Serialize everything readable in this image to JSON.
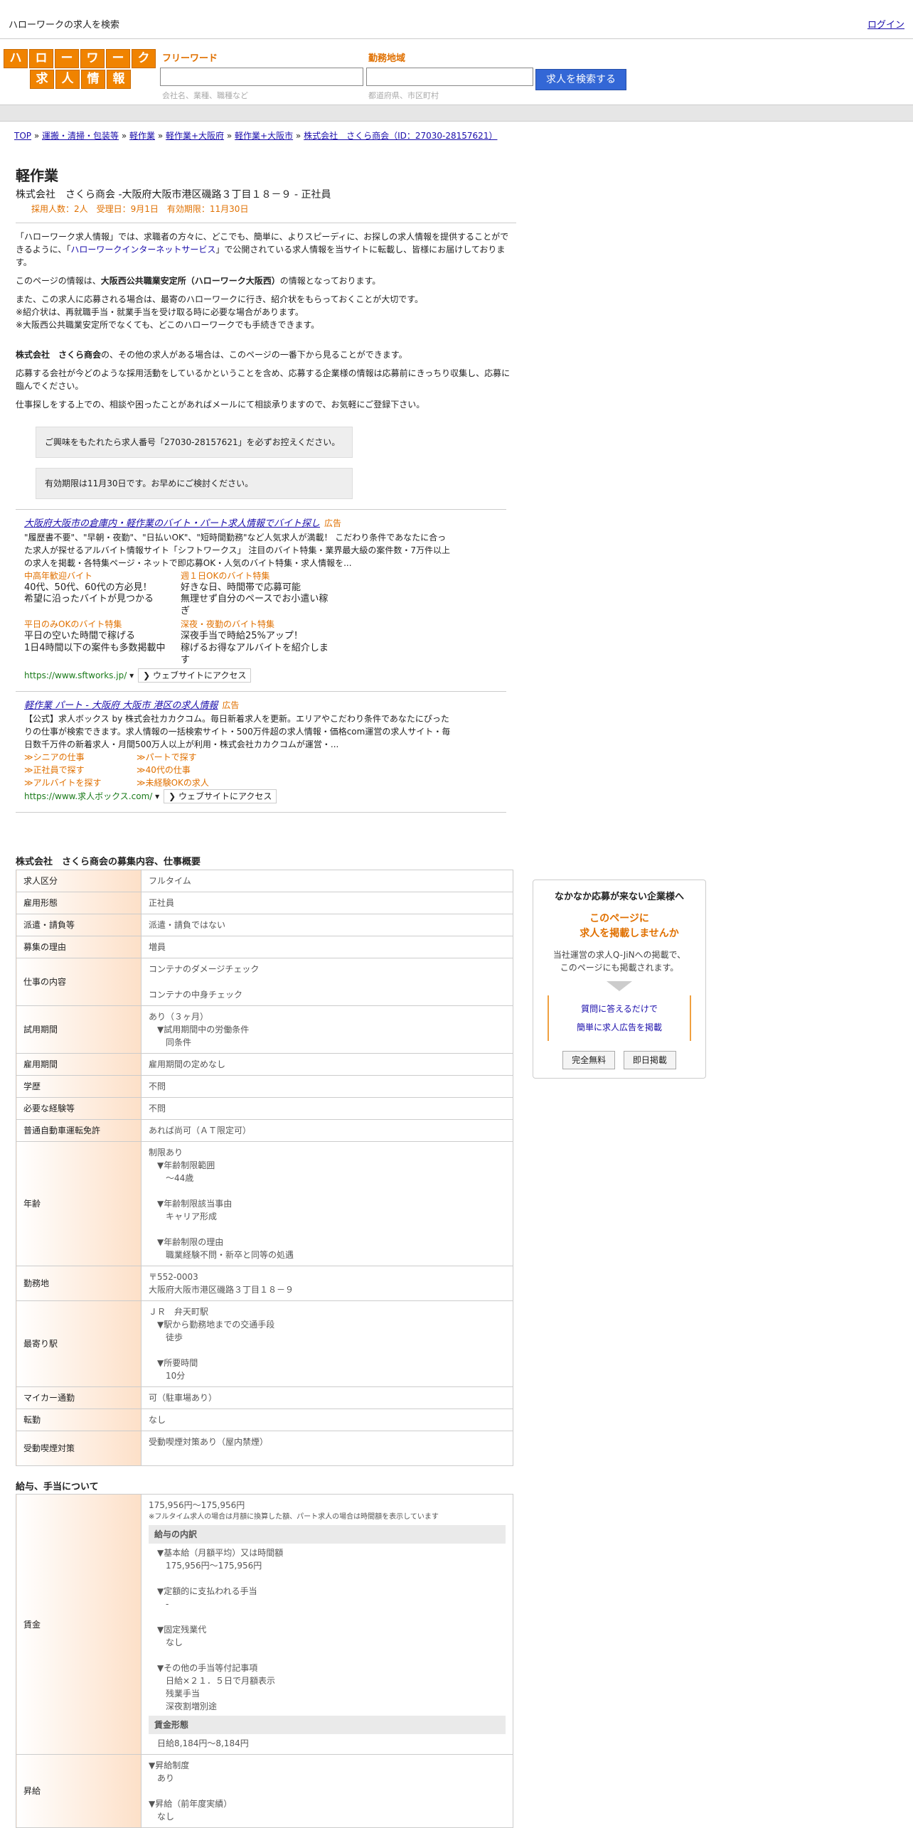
{
  "topbar": {
    "site_title": "ハローワークの求人を検索",
    "login": "ログイン"
  },
  "logo": {
    "row1": [
      "ハ",
      "ロ",
      "ー",
      "ワ",
      "ー",
      "ク"
    ],
    "row2": [
      "求",
      "人",
      "情",
      "報"
    ]
  },
  "search": {
    "keyword_label": "フリーワード",
    "keyword_hint": "会社名、業種、職種など",
    "area_label": "勤務地域",
    "area_hint": "都道府県、市区町村",
    "button": "求人を検索する"
  },
  "breadcrumb": [
    "TOP",
    "運搬・清掃・包装等",
    "軽作業",
    "軽作業+大阪府",
    "軽作業+大阪市",
    "株式会社　さくら商会（ID：27030-28157621）"
  ],
  "job": {
    "title": "軽作業",
    "company_line": "株式会社　さくら商会 -大阪府大阪市港区磯路３丁目１８－９ - 正社員",
    "meta": "採用人数：2人　受理日：9月1日　有効期限：11月30日"
  },
  "intro": {
    "p1_a": "「ハローワーク求人情報」では、求職者の方々に、どこでも、簡単に、よりスピーディに、お探しの求人情報を提供することができるように、「",
    "p1_link": "ハローワークインターネットサービス",
    "p1_b": "」で公開されている求人情報を当サイトに転載し、皆様にお届けしております。",
    "p2_a": "このページの情報は、",
    "p2_bold": "大阪西公共職業安定所（ハローワーク大阪西）",
    "p2_b": "の情報となっております。",
    "p3_1": "また、この求人に応募される場合は、最寄のハローワークに行き、紹介状をもらっておくことが大切です。",
    "p3_2": "※紹介状は、再就職手当・就業手当を受け取る時に必要な場合があります。",
    "p3_3": "※大阪西公共職業安定所でなくても、どこのハローワークでも手続きできます。",
    "p4_bold": "株式会社　さくら商会",
    "p4_b": "の、その他の求人がある場合は、このページの一番下から見ることができます。",
    "p5": "応募する会社が今どのような採用活動をしているかということを含め、応募する企業様の情報は応募前にきっちり収集し、応募に臨んでください。",
    "p6": "仕事探しをする上での、相談や困ったことがあればメールにて相談承りますので、お気軽にご登録下さい。"
  },
  "notes": {
    "n1": "ご興味をもたれたら求人番号「27030-28157621」を必ずお控えください。",
    "n2": "有効期限は11月30日です。お早めにご検討ください。"
  },
  "ad1": {
    "title": "大阪府大阪市の倉庫内・軽作業のバイト・パート求人情報でバイト探し",
    "tag": "広告",
    "desc": "\"履歴書不要\"、\"早朝・夜勤\"、\"日払いOK\"、\"短時間勤務\"など人気求人が満載！ こだわり条件であなたに合った求人が探せるアルバイト情報サイト「シフトワークス」 注目のバイト特集・業界最大級の案件数・7万件以上の求人を掲載・各特集ページ・ネットで即応募OK・人気のバイト特集・求人情報を...",
    "links": [
      {
        "hd": "中高年歓迎バイト",
        "l1": "40代、50代、60代の方必見！",
        "l2": "希望に沿ったバイトが見つかる"
      },
      {
        "hd": "週１日OKのバイト特集",
        "l1": "好きな日、時間帯で応募可能",
        "l2": "無理せず自分のペースでお小遣い稼ぎ"
      },
      {
        "hd": "平日のみOKのバイト特集",
        "l1": "平日の空いた時間で稼げる",
        "l2": "1日4時間以下の案件も多数掲載中"
      },
      {
        "hd": "深夜・夜勤のバイト特集",
        "l1": "深夜手当で時給25%アップ！",
        "l2": "稼げるお得なアルバイトを紹介します"
      }
    ],
    "url": "https://www.sftworks.jp/",
    "web_btn": "ウェブサイトにアクセス"
  },
  "ad2": {
    "title": "軽作業 パート - 大阪府 大阪市 港区の求人情報",
    "tag": "広告",
    "desc": "【公式】求人ボックス by 株式会社カカクコム。毎日新着求人を更新。エリアやこだわり条件であなたにぴったりの仕事が検索できます。求人情報の一括検索サイト・500万件超の求人情報・価格com運営の求人サイト・毎日数千万件の新着求人・月間500万人以上が利用・株式会社カカクコムが運営・...",
    "links": [
      "≫シニアの仕事",
      "≫パートで探す",
      "≫正社員で探す",
      "≫40代の仕事",
      "≫アルバイトを探す",
      "≫未経験OKの求人"
    ],
    "url": "https://www.求人ボックス.com/",
    "web_btn": "ウェブサイトにアクセス"
  },
  "overview": {
    "title": "株式会社　さくら商会の募集内容、仕事概要",
    "rows": [
      {
        "k": "求人区分",
        "v": [
          "フルタイム"
        ]
      },
      {
        "k": "雇用形態",
        "v": [
          "正社員"
        ]
      },
      {
        "k": "派遣・請負等",
        "v": [
          "派遣・請負ではない"
        ]
      },
      {
        "k": "募集の理由",
        "v": [
          "増員"
        ]
      },
      {
        "k": "仕事の内容",
        "v": [
          "コンテナのダメージチェック",
          "",
          "コンテナの中身チェック"
        ]
      },
      {
        "k": "試用期間",
        "v": [
          "あり（３ヶ月）",
          "　▼試用期間中の労働条件",
          "　　同条件"
        ]
      },
      {
        "k": "雇用期間",
        "v": [
          "雇用期間の定めなし"
        ]
      },
      {
        "k": "学歴",
        "v": [
          "不問"
        ]
      },
      {
        "k": "必要な経験等",
        "v": [
          "不問"
        ]
      },
      {
        "k": "普通自動車運転免許",
        "v": [
          "あれば尚可（ＡＴ限定可）"
        ]
      },
      {
        "k": "年齢",
        "v": [
          "制限あり",
          "　▼年齢制限範囲",
          "　　～44歳",
          "",
          "　▼年齢制限該当事由",
          "　　キャリア形成",
          "",
          "　▼年齢制限の理由",
          "　　職業経験不問・新卒と同等の処遇"
        ]
      },
      {
        "k": "勤務地",
        "v": [
          "〒552-0003",
          "大阪府大阪市港区磯路３丁目１８－９"
        ]
      },
      {
        "k": "最寄り駅",
        "v": [
          "ＪＲ　弁天町駅",
          "　▼駅から勤務地までの交通手段",
          "　　徒歩",
          "",
          "　▼所要時間",
          "　　10分"
        ]
      },
      {
        "k": "マイカー通勤",
        "v": [
          "可（駐車場あり）"
        ]
      },
      {
        "k": "転勤",
        "v": [
          "なし"
        ]
      },
      {
        "k": "受動喫煙対策",
        "v": [
          "受動喫煙対策あり（屋内禁煙）",
          ""
        ]
      }
    ]
  },
  "salary": {
    "title": "給与、手当について",
    "wage_label": "賃金",
    "wage_range": "175,956円〜175,956円",
    "wage_note": "※フルタイム求人の場合は月額に換算した額、パート求人の場合は時間額を表示しています",
    "breakdown_hdr": "給与の内訳",
    "breakdown": [
      "▼基本給（月額平均）又は時間額",
      "　175,956円〜175,956円",
      "",
      "▼定額的に支払われる手当",
      "　-",
      "",
      "▼固定残業代",
      "　なし",
      "",
      "▼その他の手当等付記事項",
      "　日給×２１．５日で月額表示",
      "　残業手当",
      "　深夜割増別途"
    ],
    "form_hdr": "賃金形態",
    "form_val": "日給8,184円〜8,184円",
    "raise_label": "昇給",
    "raise": [
      "▼昇給制度",
      "　あり",
      "",
      "▼昇給（前年度実績）",
      "　なし"
    ]
  },
  "sidebox": {
    "title": "なかなか応募が来ない企業様へ",
    "orange1": "このページに",
    "orange2": "求人を掲載しませんか",
    "body1": "当社運営の求人Q-JiNへの掲載で、",
    "body2": "このページにも掲載されます。",
    "link1": "質問に答えるだけで",
    "link2": "簡単に求人広告を掲載",
    "btn1": "完全無料",
    "btn2": "即日掲載"
  }
}
